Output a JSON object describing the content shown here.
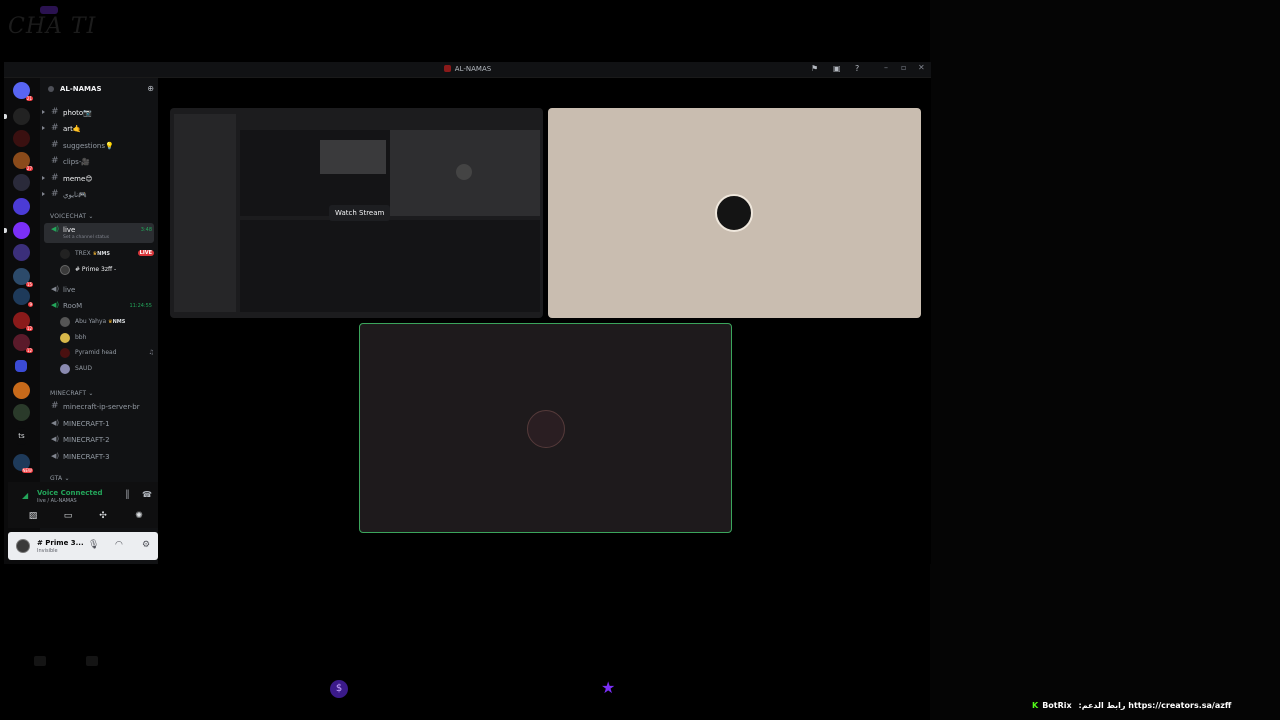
{
  "overlay": {
    "watermark": "CHA TI",
    "botrix_label": "BotRix",
    "botrix_text": ":رابط الدعم https://creators.sa/azff"
  },
  "window": {
    "title": "AL-NAMAS"
  },
  "icons": {
    "threads": "flag-icon",
    "inbox": "inbox-icon",
    "help": "help-icon"
  },
  "servers": [
    {
      "badge": "21"
    },
    {
      "badge": ""
    },
    {
      "badge": ""
    },
    {
      "badge": "27"
    },
    {
      "badge": ""
    },
    {
      "badge": ""
    },
    {
      "badge": ""
    },
    {
      "badge": ""
    },
    {
      "badge": "15"
    },
    {
      "badge": "9"
    },
    {
      "badge": "12"
    },
    {
      "badge": "12"
    },
    {
      "badge": ""
    },
    {
      "badge": ""
    },
    {
      "badge": ""
    },
    {
      "badge": ""
    },
    {
      "badge": "NEW"
    }
  ],
  "guild": {
    "name": "AL-NAMAS"
  },
  "text_channels": [
    {
      "name": "photo📷"
    },
    {
      "name": "art🤙"
    },
    {
      "name": "suggestions💡"
    },
    {
      "name": "clips-🎥"
    },
    {
      "name": "meme😊"
    },
    {
      "name": "نايوي🎮"
    }
  ],
  "voicechat": {
    "category": "VOICECHAT",
    "live_channel": "live",
    "live_time": "3:48",
    "live_status": "Set a channel status",
    "live_users": [
      {
        "name": "TREX",
        "tag": "NMS",
        "live": "LIVE"
      },
      {
        "name": "# Prime 3zff -",
        "tag": "",
        "live": ""
      }
    ],
    "live2_channel": "live",
    "room_channel": "RooM",
    "room_time": "11:24:55",
    "room_users": [
      {
        "name": "Abu Yahya",
        "tag": "NMS"
      },
      {
        "name": "bbh",
        "tag": ""
      },
      {
        "name": "Pyramid head",
        "tag": ""
      },
      {
        "name": "SAUD",
        "tag": ""
      }
    ]
  },
  "minecraft": {
    "category": "MINECRAFT",
    "channels": [
      {
        "name": "minecraft-ip-server-br"
      },
      {
        "name": "MINECRAFT-1"
      },
      {
        "name": "MINECRAFT-2"
      },
      {
        "name": "MINECRAFT-3"
      }
    ]
  },
  "gta": {
    "category": "GTA"
  },
  "voice_panel": {
    "status": "Voice Connected",
    "location": "live / AL-NAMAS"
  },
  "user_panel": {
    "name": "# Prime 3...",
    "status": "Invisible"
  },
  "stage": {
    "watch_stream": "Watch Stream"
  },
  "colors": {
    "voice_green": "#23a55a",
    "live_red": "#da373c",
    "camera_bg": "#c9bdb0",
    "self_border": "#3ba55c",
    "accent_purple": "#7b2ff7"
  }
}
